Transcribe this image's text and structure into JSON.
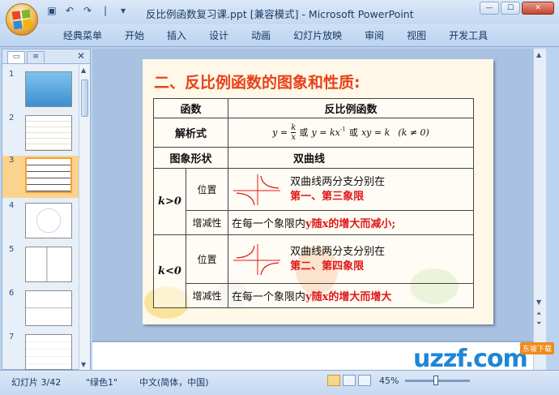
{
  "window": {
    "title": "反比例函数复习课.ppt [兼容模式] - Microsoft PowerPoint",
    "minimize": "—",
    "maximize": "☐",
    "close": "✕"
  },
  "qat": {
    "save_icon": "save-icon",
    "undo": "↶",
    "redo": "↷",
    "separator": "|",
    "customize": "▾"
  },
  "ribbon": {
    "tabs": [
      "经典菜单",
      "开始",
      "插入",
      "设计",
      "动画",
      "幻灯片放映",
      "审阅",
      "视图",
      "开发工具"
    ]
  },
  "panel": {
    "close": "✕",
    "thumbnails": [
      {
        "num": "1",
        "selected": false
      },
      {
        "num": "2",
        "selected": false
      },
      {
        "num": "3",
        "selected": true
      },
      {
        "num": "4",
        "selected": false
      },
      {
        "num": "5",
        "selected": false
      },
      {
        "num": "6",
        "selected": false
      },
      {
        "num": "7",
        "selected": false
      }
    ]
  },
  "slide": {
    "title": "二、反比例函数的图象和性质:",
    "header_col1": "函数",
    "header_col2": "反比例函数",
    "row_formula_label": "解析式",
    "formula_y": "y =",
    "formula_k": "k",
    "formula_x": "x",
    "formula_or1": "或",
    "formula_y2": "y = kx",
    "formula_exp": "-1",
    "formula_or2": "或",
    "formula_xy": "xy = k",
    "formula_cond": "(k ≠ 0)",
    "row_shape_label": "图象形状",
    "row_shape_value": "双曲线",
    "k_pos_label": "k>0",
    "k_neg_label": "k<0",
    "position_label": "位置",
    "trend_label": "增减性",
    "pos_k_pos_line1": "双曲线两分支分别在",
    "pos_k_pos_line2": "第一、第三象限",
    "trend_k_pos_prefix": "在每一个象限内",
    "trend_k_pos_red": "y随x的增大而减小;",
    "pos_k_neg_line1": "双曲线两分支分别在",
    "pos_k_neg_line2": "第二、第四象限",
    "trend_k_neg_prefix": "在每一个象限内",
    "trend_k_neg_red": "y随x的增大而增大"
  },
  "status": {
    "slide_info": "幻灯片 3/42",
    "theme": "\"绿色1\"",
    "language": "中文(简体，中国)",
    "zoom": "45%"
  },
  "watermark": {
    "text": "uzzf.com",
    "badge": "东坡下载"
  },
  "colors": {
    "accent": "#e8421a",
    "red_text": "#e01818",
    "selection": "#f1a040"
  }
}
